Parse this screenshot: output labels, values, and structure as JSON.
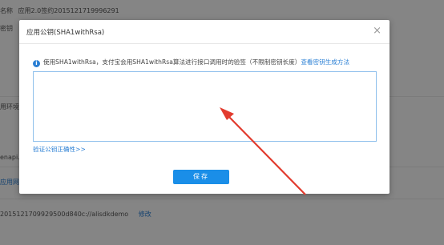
{
  "background": {
    "row1_label": "名称",
    "row1_value": "应用2.0签约2015121719996291",
    "row2_label": "密钥",
    "env_fragment": "用环境,",
    "api_fragment": "enapi.a",
    "app_fragment": "应用网",
    "bottom_value": "2015121709929500d840c://alisdkdemo",
    "bottom_link": "修改"
  },
  "modal": {
    "title": "应用公钥(SHA1withRsa)",
    "close": "×",
    "notice_text": "使用SHA1withRsa，支付宝会用SHA1withRsa算法进行接口调用时的验签（不限制密钥长度）",
    "notice_link": "查看密钥生成方法",
    "verify_link": "验证公钥正确性>>",
    "save_label": "保存"
  },
  "colors": {
    "accent": "#1a8ee8",
    "link": "#2a7fd4",
    "annotation_arrow": "#e23b2e"
  },
  "icons": {
    "info": "info-circle-icon",
    "close": "close-icon"
  }
}
